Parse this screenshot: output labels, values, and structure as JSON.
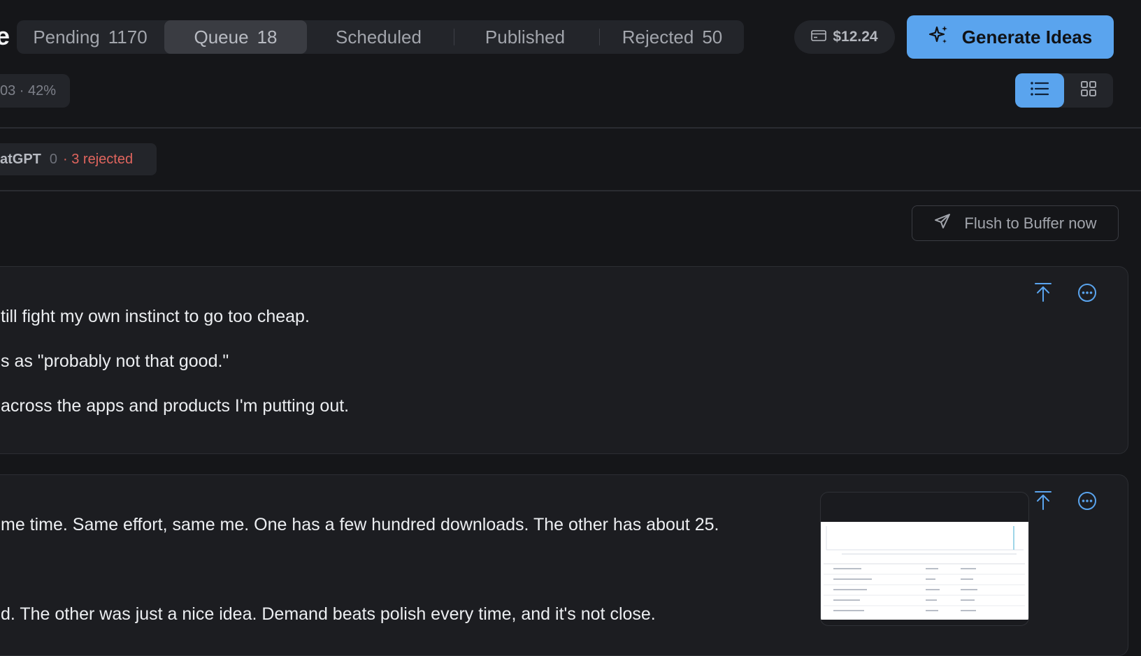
{
  "header": {
    "title_fragment": "e",
    "tabs": [
      {
        "label": "Pending",
        "count": "1170"
      },
      {
        "label": "Queue",
        "count": "18"
      },
      {
        "label": "Scheduled",
        "count": ""
      },
      {
        "label": "Published",
        "count": ""
      },
      {
        "label": "Rejected",
        "count": "50"
      }
    ],
    "active_tab": "Queue",
    "credit": "$12.24",
    "generate_label": "Generate Ideas"
  },
  "toolbar": {
    "stat_text": "03 · 42%",
    "view_mode": "list"
  },
  "filter": {
    "name": "atGPT",
    "count": "0",
    "rejected": "· 3 rejected"
  },
  "queue": {
    "flush_label": "Flush to Buffer now"
  },
  "posts": [
    {
      "lines": [
        "till fight my own instinct to go too cheap.",
        "s as \"probably not that good.\"",
        "across the apps and products I'm putting out."
      ]
    },
    {
      "lines": [
        "me time. Same effort, same me. One has a few hundred downloads. The other has about 25.",
        "d. The other was just a nice idea. Demand beats polish every time, and it's not close."
      ],
      "has_thumbnail": true
    }
  ],
  "colors": {
    "accent": "#5aa4ee",
    "reject": "#e0655e",
    "background": "#151619",
    "card": "#1c1d21"
  },
  "icons": [
    "credit-card-icon",
    "sparkles-icon",
    "list-view-icon",
    "grid-view-icon",
    "send-icon",
    "move-to-top-icon",
    "more-options-icon"
  ]
}
